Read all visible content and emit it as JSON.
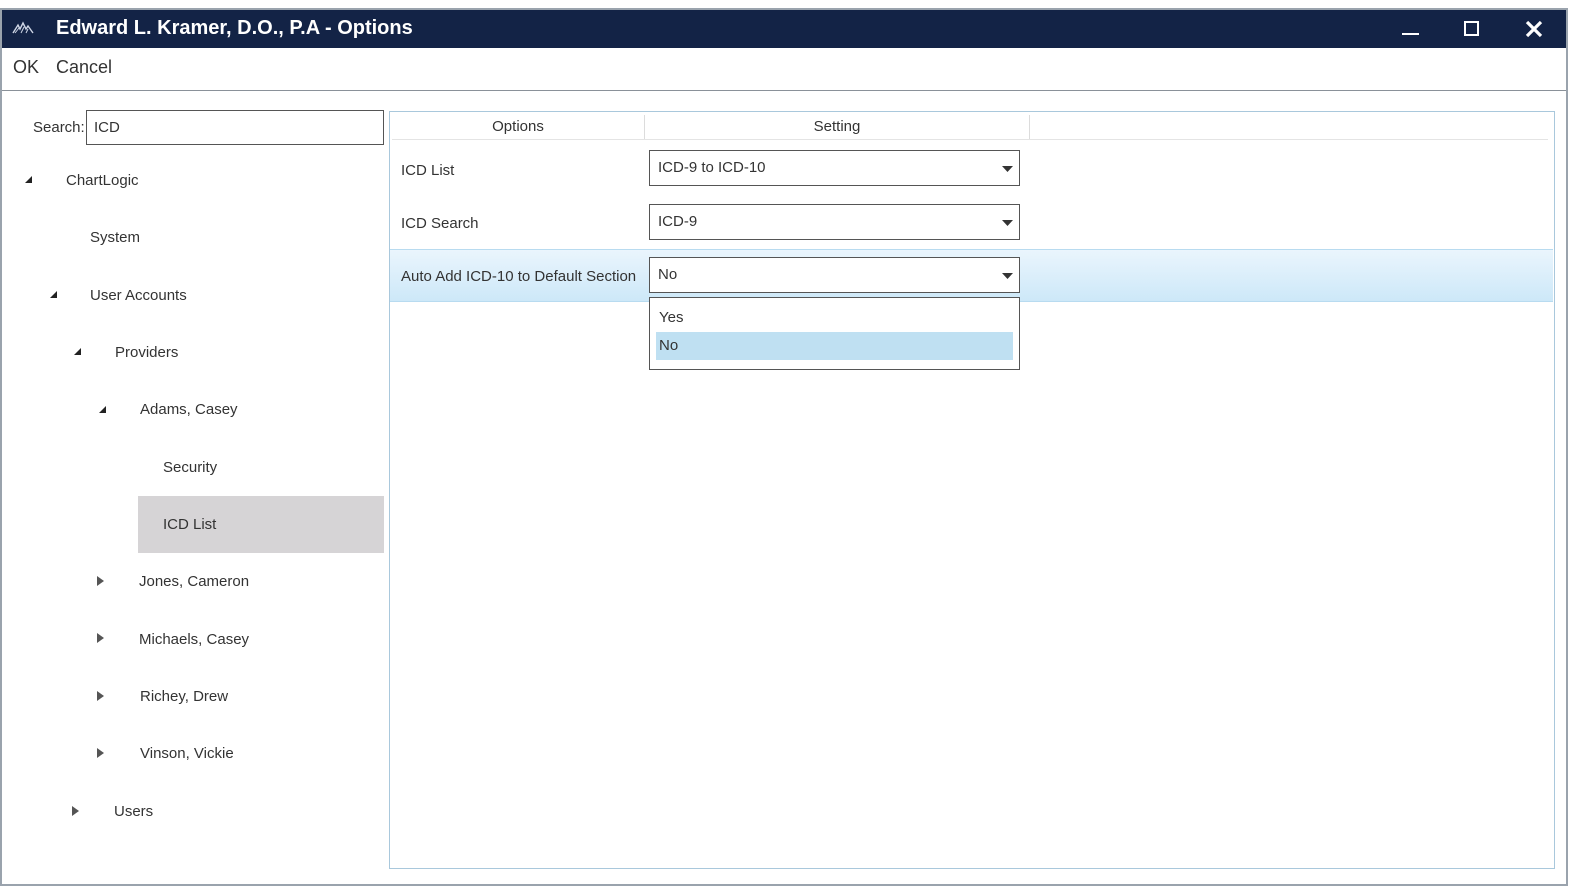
{
  "window": {
    "title": "Edward L. Kramer, D.O., P.A - Options"
  },
  "window_controls": [
    "minimize-icon",
    "maximize-icon",
    "close-icon"
  ],
  "menu": {
    "ok": "OK",
    "cancel": "Cancel"
  },
  "search": {
    "label": "Search:",
    "value": "ICD"
  },
  "tree": {
    "chartlogic": "ChartLogic",
    "system": "System",
    "user_accounts": "User Accounts",
    "providers": "Providers",
    "adams_casey": "Adams, Casey",
    "security": "Security",
    "icd_list": "ICD List",
    "jones_cameron": "Jones, Cameron",
    "michaels_casey": "Michaels, Casey",
    "richey_drew": "Richey, Drew",
    "vinson_vickie": "Vinson, Vickie",
    "users": "Users",
    "selected": "ICD List"
  },
  "grid": {
    "header_options": "Options",
    "header_setting": "Setting",
    "rows": [
      {
        "label": "ICD List",
        "value": "ICD-9 to ICD-10"
      },
      {
        "label": "ICD Search",
        "value": "ICD-9"
      },
      {
        "label": "Auto Add ICD-10 to Default Section",
        "value": "No"
      }
    ],
    "dropdown_options": [
      "Yes",
      "No"
    ],
    "dropdown_selected": "No"
  },
  "colors": {
    "titlebar": "#132346",
    "selected_tree_item": "#d6d4d6",
    "row_highlight": "#cde8f8",
    "dropdown_selected": "#bfe0f2"
  }
}
